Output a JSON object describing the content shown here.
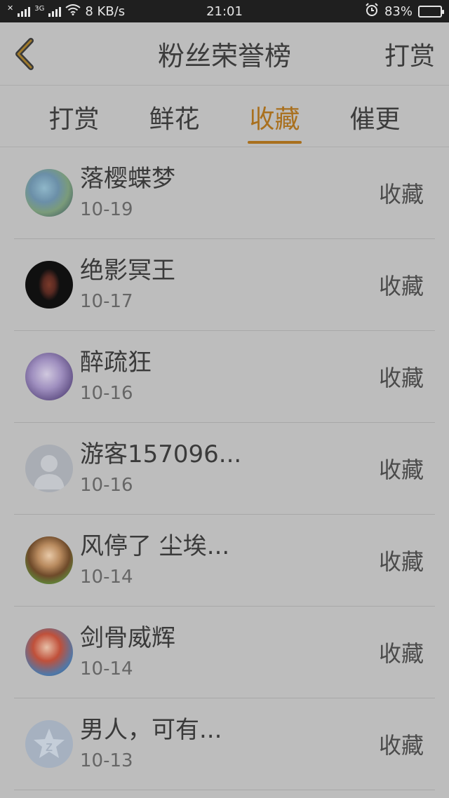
{
  "status_bar": {
    "network_badge": "3G",
    "speed": "8 KB/s",
    "time": "21:01",
    "battery": "83%",
    "battery_level": 0.83
  },
  "header": {
    "title": "粉丝荣誉榜",
    "right_action": "打赏"
  },
  "tabs": [
    {
      "label": "打赏",
      "active": false
    },
    {
      "label": "鲜花",
      "active": false
    },
    {
      "label": "收藏",
      "active": true
    },
    {
      "label": "催更",
      "active": false
    }
  ],
  "fans": [
    {
      "name": "落樱蝶梦",
      "date": "10-19",
      "action": "收藏"
    },
    {
      "name": "绝影冥王",
      "date": "10-17",
      "action": "收藏"
    },
    {
      "name": "醉疏狂",
      "date": "10-16",
      "action": "收藏"
    },
    {
      "name": "游客157096...",
      "date": "10-16",
      "action": "收藏"
    },
    {
      "name": "风停了 尘埃...",
      "date": "10-14",
      "action": "收藏"
    },
    {
      "name": "剑骨威辉",
      "date": "10-14",
      "action": "收藏"
    },
    {
      "name": "男人，可有...",
      "date": "10-13",
      "action": "收藏"
    }
  ],
  "colors": {
    "accent": "#a9701e",
    "overlay_background": "#bdbdbd",
    "status_bar": "#1f1f1f"
  }
}
